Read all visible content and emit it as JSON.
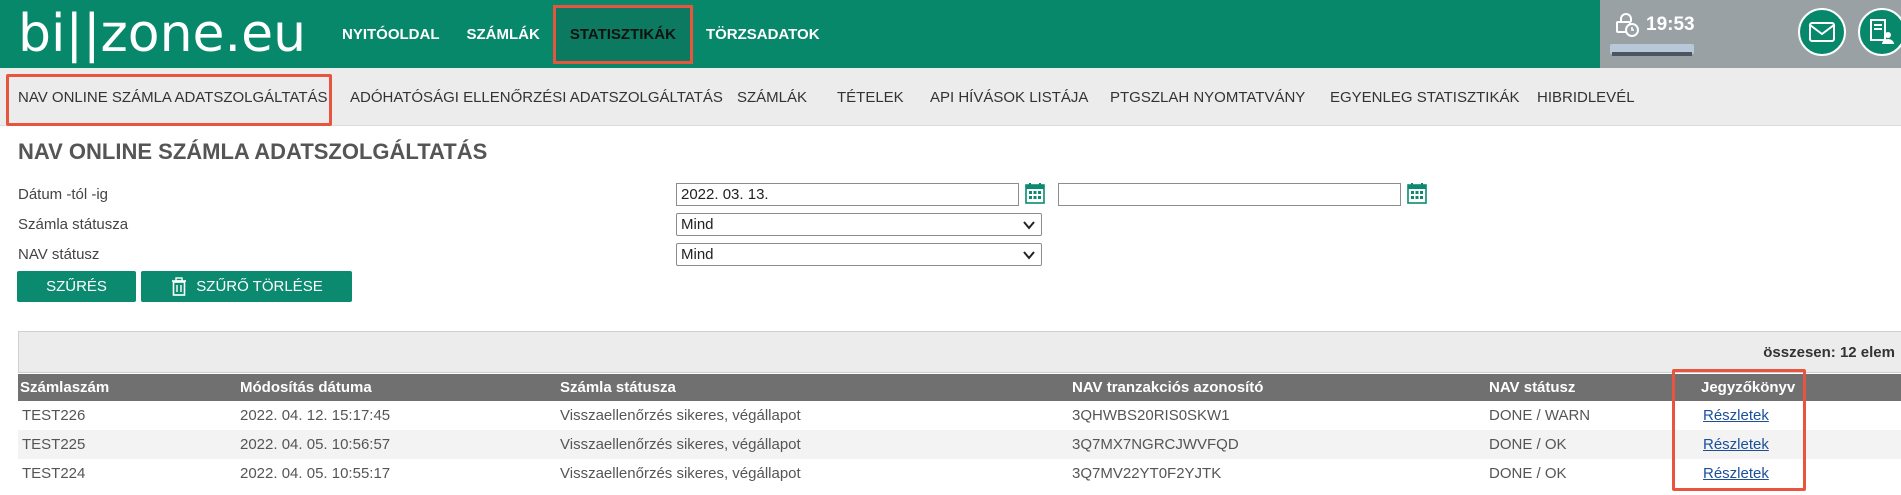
{
  "header": {
    "logo": "bi||zone.eu",
    "nav": [
      "NYITÓOLDAL",
      "SZÁMLÁK",
      "STATISZTIKÁK",
      "TÖRZSADATOK"
    ],
    "clock": "19:53"
  },
  "subnav": [
    "NAV ONLINE SZÁMLA ADATSZOLGÁLTATÁS",
    "ADÓHATÓSÁGI ELLENŐRZÉSI ADATSZOLGÁLTATÁS",
    "SZÁMLÁK",
    "TÉTELEK",
    "API HÍVÁSOK LISTÁJA",
    "PTGSZLAH NYOMTATVÁNY",
    "EGYENLEG STATISZTIKÁK",
    "HIBRIDLEVÉL"
  ],
  "page_title": "NAV ONLINE SZÁMLA ADATSZOLGÁLTATÁS",
  "filters": {
    "date_label": "Dátum -tól -ig",
    "date_from": "2022. 03. 13.",
    "date_to": "",
    "status_label": "Számla státusza",
    "status_value": "Mind",
    "nav_status_label": "NAV státusz",
    "nav_status_value": "Mind",
    "filter_button": "SZŰRÉS",
    "clear_button": "SZŰRŐ TÖRLÉSE"
  },
  "table": {
    "total": "összesen: 12 elem",
    "headers": [
      "Számlaszám",
      "Módosítás dátuma",
      "Számla státusza",
      "NAV tranzakciós azonosító",
      "NAV státusz",
      "Jegyzőkönyv"
    ],
    "rows": [
      [
        "TEST226",
        "2022. 04. 12. 15:17:45",
        "Visszaellenőrzés sikeres, végállapot",
        "3QHWBS20RIS0SKW1",
        "DONE / WARN",
        "Részletek"
      ],
      [
        "TEST225",
        "2022. 04. 05. 10:56:57",
        "Visszaellenőrzés sikeres, végállapot",
        "3Q7MX7NGRCJWVFQD",
        "DONE / OK",
        "Részletek"
      ],
      [
        "TEST224",
        "2022. 04. 05. 10:55:17",
        "Visszaellenőrzés sikeres, végállapot",
        "3Q7MV22YT0F2YJTK",
        "DONE / OK",
        "Részletek"
      ]
    ]
  },
  "colors": {
    "brand_green": "#07886b",
    "highlight_red": "#e8553e"
  }
}
